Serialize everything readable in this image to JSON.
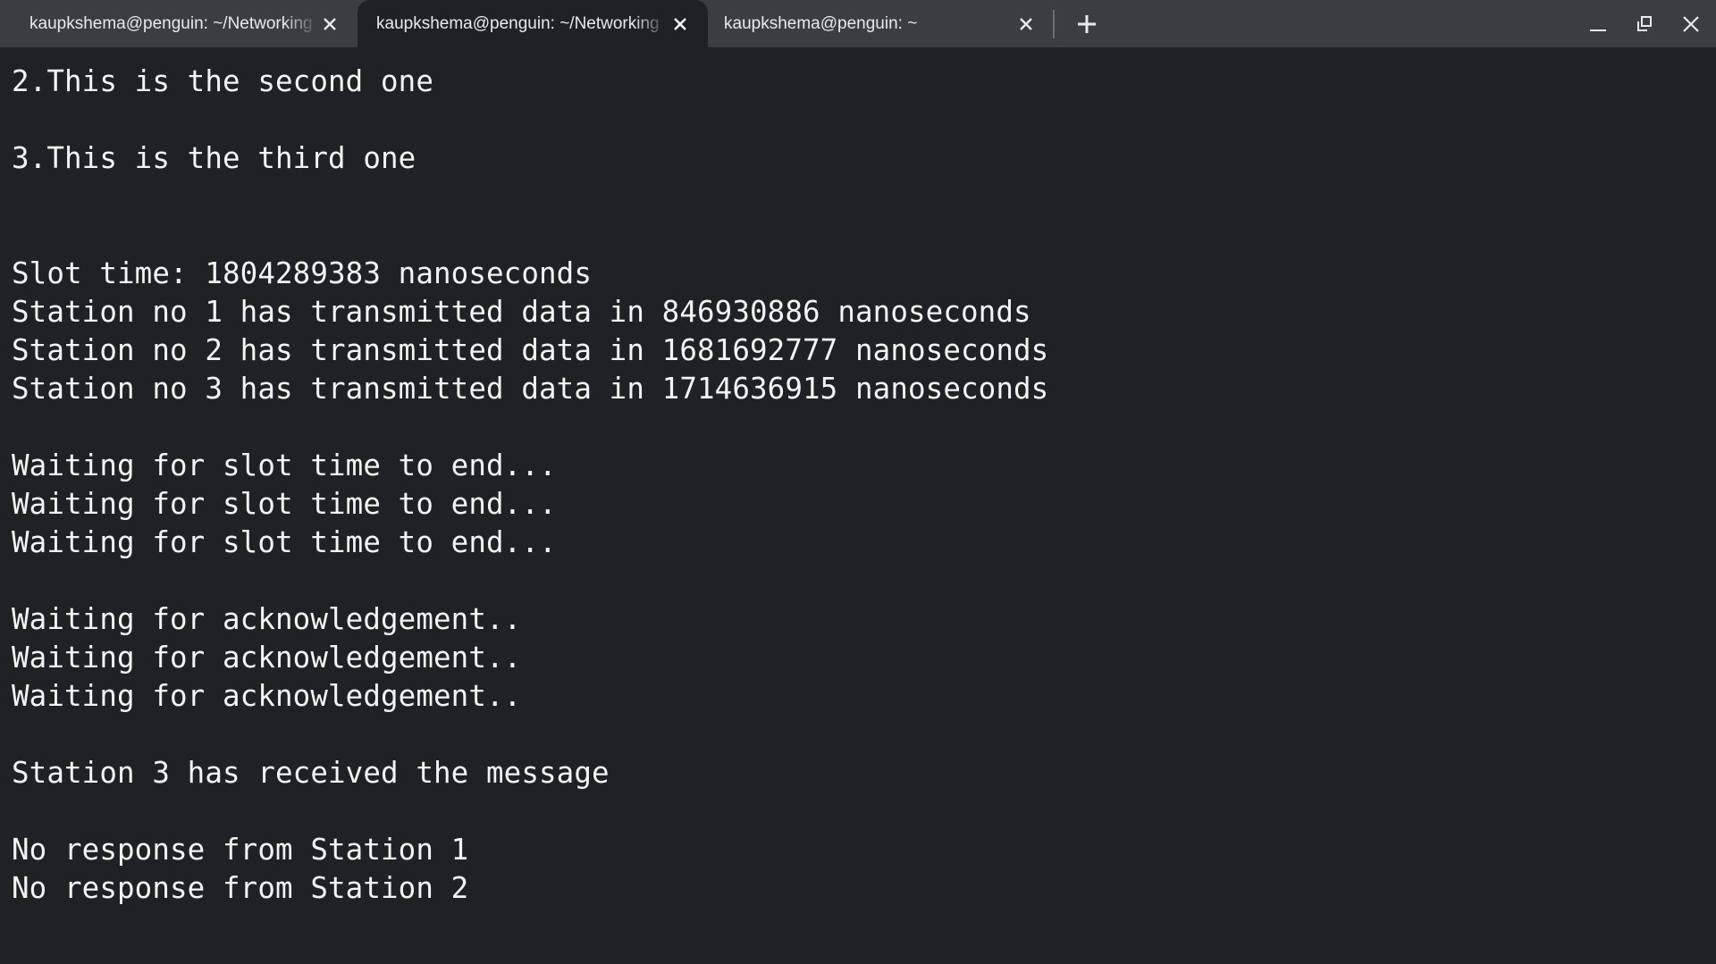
{
  "tabs": [
    {
      "title": "kaupkshema@penguin: ~/Networking",
      "active": false,
      "close_icon": "close-icon"
    },
    {
      "title": "kaupkshema@penguin: ~/Networking",
      "active": true,
      "close_icon": "close-icon"
    },
    {
      "title": "kaupkshema@penguin: ~",
      "active": false,
      "close_icon": "close-icon"
    }
  ],
  "toolbar": {
    "new_tab_icon": "plus-icon",
    "minimize_icon": "minimize-icon",
    "restore_icon": "restore-icon",
    "close_icon": "close-icon"
  },
  "colors": {
    "tabbar_bg": "#3c3d41",
    "terminal_bg": "#202124",
    "text": "#f1f3f4"
  },
  "terminal": {
    "lines": [
      "2.This is the second one",
      "",
      "3.This is the third one",
      "",
      "",
      "Slot time: 1804289383 nanoseconds",
      "Station no 1 has transmitted data in 846930886 nanoseconds",
      "Station no 2 has transmitted data in 1681692777 nanoseconds",
      "Station no 3 has transmitted data in 1714636915 nanoseconds",
      "",
      "Waiting for slot time to end...",
      "Waiting for slot time to end...",
      "Waiting for slot time to end...",
      "",
      "Waiting for acknowledgement..",
      "Waiting for acknowledgement..",
      "Waiting for acknowledgement..",
      "",
      "Station 3 has received the message",
      "",
      "No response from Station 1",
      "No response from Station 2"
    ]
  }
}
